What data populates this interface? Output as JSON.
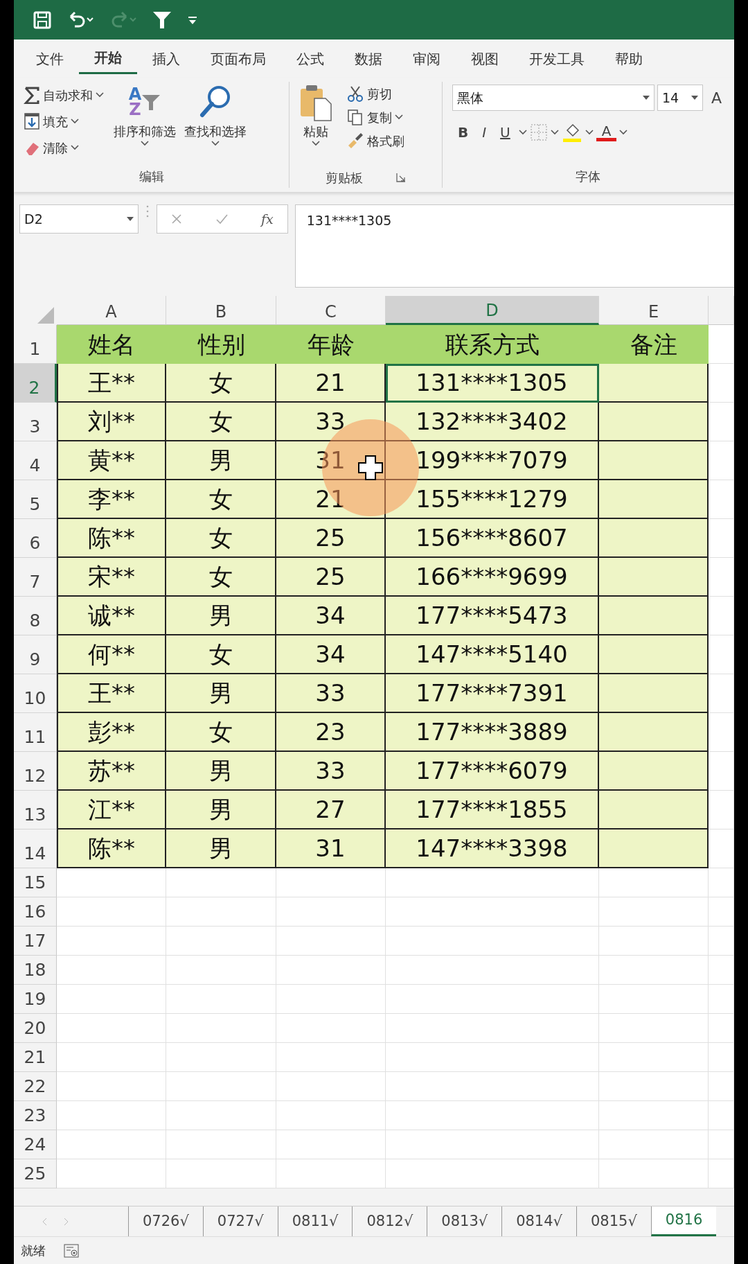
{
  "ribbon_tabs": [
    {
      "label": "文件",
      "selected": false
    },
    {
      "label": "开始",
      "selected": true
    },
    {
      "label": "插入",
      "selected": false
    },
    {
      "label": "页面布局",
      "selected": false
    },
    {
      "label": "公式",
      "selected": false
    },
    {
      "label": "数据",
      "selected": false
    },
    {
      "label": "审阅",
      "selected": false
    },
    {
      "label": "视图",
      "selected": false
    },
    {
      "label": "开发工具",
      "selected": false
    },
    {
      "label": "帮助",
      "selected": false
    }
  ],
  "editing_group": {
    "name": "编辑",
    "small_buttons": [
      {
        "kind": "autosum",
        "label": "自动求和"
      },
      {
        "kind": "fill",
        "label": "填充"
      },
      {
        "kind": "clear",
        "label": "清除"
      }
    ],
    "sort_glyphs": [
      "A",
      "Z"
    ],
    "large_buttons": [
      {
        "kind": "sort",
        "label": "排序和筛选"
      },
      {
        "kind": "find",
        "label": "查找和选择"
      }
    ]
  },
  "clipboard_group": {
    "name": "剪贴板",
    "paste_label": "粘贴",
    "small_buttons": [
      {
        "kind": "cut",
        "label": "剪切",
        "dropdown": false
      },
      {
        "kind": "copy",
        "label": "复制",
        "dropdown": true
      },
      {
        "kind": "painter",
        "label": "格式刷",
        "dropdown": false
      }
    ]
  },
  "font_group": {
    "name": "字体",
    "font_name": "黑体",
    "font_size": "14",
    "grow_glyph": "A",
    "format_buttons": [
      "B",
      "I",
      "U"
    ],
    "font_color_glyph": "A"
  },
  "formula_bar": {
    "name_box": "D2",
    "function_glyph": "fx",
    "formula": "131****1305"
  },
  "columns": [
    {
      "label": "A",
      "selected": false
    },
    {
      "label": "B",
      "selected": false
    },
    {
      "label": "C",
      "selected": false
    },
    {
      "label": "D",
      "selected": true
    },
    {
      "label": "E",
      "selected": false
    }
  ],
  "header_row": {
    "number": "1",
    "cells": [
      "姓名",
      "性别",
      "年龄",
      "联系方式",
      "备注"
    ]
  },
  "rows": [
    {
      "number": "2",
      "selected": true,
      "cells": [
        "王**",
        "女",
        "21",
        "131****1305"
      ]
    },
    {
      "number": "3",
      "selected": false,
      "cells": [
        "刘**",
        "女",
        "33",
        "132****3402"
      ]
    },
    {
      "number": "4",
      "selected": false,
      "cells": [
        "黄**",
        "男",
        "31",
        "199****7079"
      ]
    },
    {
      "number": "5",
      "selected": false,
      "cells": [
        "李**",
        "女",
        "21",
        "155****1279"
      ]
    },
    {
      "number": "6",
      "selected": false,
      "cells": [
        "陈**",
        "女",
        "25",
        "156****8607"
      ]
    },
    {
      "number": "7",
      "selected": false,
      "cells": [
        "宋**",
        "女",
        "25",
        "166****9699"
      ]
    },
    {
      "number": "8",
      "selected": false,
      "cells": [
        "诚**",
        "男",
        "34",
        "177****5473"
      ]
    },
    {
      "number": "9",
      "selected": false,
      "cells": [
        "何**",
        "女",
        "34",
        "147****5140"
      ]
    },
    {
      "number": "10",
      "selected": false,
      "cells": [
        "王**",
        "男",
        "33",
        "177****7391"
      ]
    },
    {
      "number": "11",
      "selected": false,
      "cells": [
        "彭**",
        "女",
        "23",
        "177****3889"
      ]
    },
    {
      "number": "12",
      "selected": false,
      "cells": [
        "苏**",
        "男",
        "33",
        "177****6079"
      ]
    },
    {
      "number": "13",
      "selected": false,
      "cells": [
        "江**",
        "男",
        "27",
        "177****1855"
      ]
    },
    {
      "number": "14",
      "selected": false,
      "cells": [
        "陈**",
        "男",
        "31",
        "147****3398"
      ]
    }
  ],
  "empty_rows": [
    "15",
    "16",
    "17",
    "18",
    "19",
    "20",
    "21",
    "22",
    "23",
    "24",
    "25"
  ],
  "sheet_tabs": [
    {
      "label": "0726√",
      "selected": false
    },
    {
      "label": "0727√",
      "selected": false
    },
    {
      "label": "0811√",
      "selected": false
    },
    {
      "label": "0812√",
      "selected": false
    },
    {
      "label": "0813√",
      "selected": false
    },
    {
      "label": "0814√",
      "selected": false
    },
    {
      "label": "0815√",
      "selected": false
    },
    {
      "label": "0816",
      "selected": true
    }
  ],
  "status_bar": {
    "text": "就绪"
  }
}
